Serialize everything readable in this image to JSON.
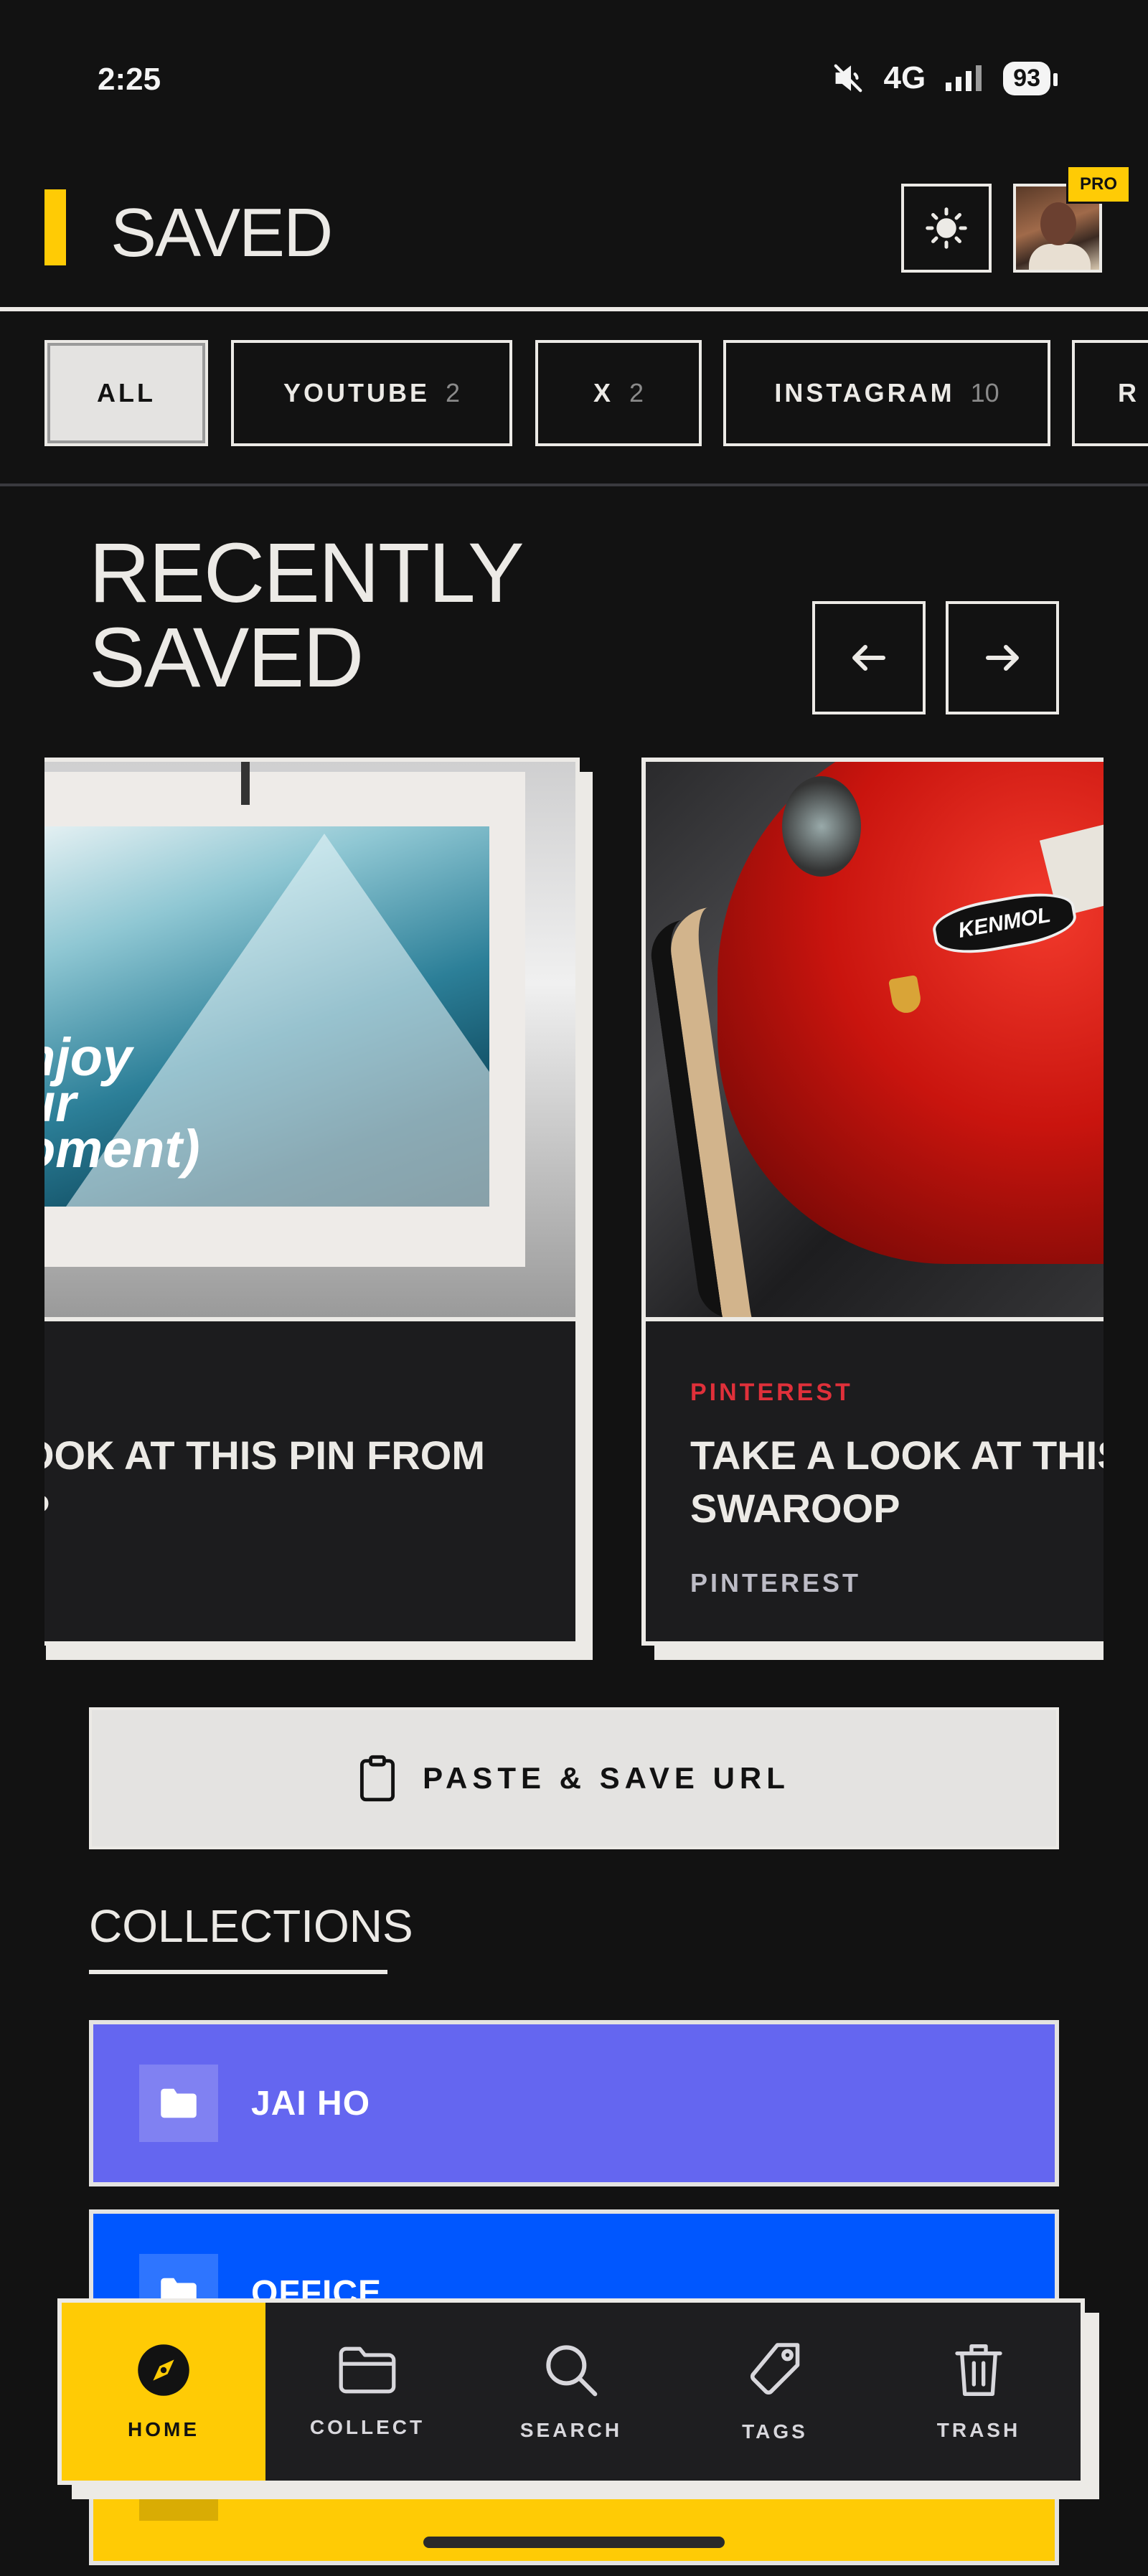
{
  "status_bar": {
    "time": "2:25",
    "network": "4G",
    "battery": "93"
  },
  "header": {
    "title": "SAVED",
    "pro_badge": "PRO"
  },
  "filters": [
    {
      "label": "ALL",
      "count": ""
    },
    {
      "label": "YOUTUBE",
      "count": "2"
    },
    {
      "label": "X",
      "count": "2"
    },
    {
      "label": "INSTAGRAM",
      "count": "10"
    },
    {
      "label": "R",
      "count": ""
    }
  ],
  "recently_saved": {
    "title_line1": "RECENTLY",
    "title_line2": "SAVED",
    "cards": [
      {
        "source": "",
        "title": "OOK AT THIS PIN FROM P",
        "title_line1": "OOK AT THIS PIN FROM",
        "title_line2": "P",
        "meta": "",
        "image_text_1": "njoy",
        "image_text_2": "ur",
        "image_text_3": "oment)"
      },
      {
        "source": "PINTEREST",
        "title_line1": "TAKE A LOOK AT THIS",
        "title_line2": "SWAROOP",
        "meta": "PINTEREST",
        "sticker": "KENMOL"
      }
    ]
  },
  "paste_button": {
    "label": "PASTE & SAVE URL"
  },
  "collections": {
    "title": "COLLECTIONS",
    "items": [
      {
        "name": "JAI HO",
        "color": "#6466F0"
      },
      {
        "name": "OFFICE",
        "color": "#0057FF"
      },
      {
        "name": "",
        "color": "#FFCB05"
      }
    ]
  },
  "bottom_nav": [
    {
      "label": "HOME",
      "icon": "compass-icon",
      "active": true
    },
    {
      "label": "COLLECT",
      "icon": "folder-icon",
      "active": false
    },
    {
      "label": "SEARCH",
      "icon": "search-icon",
      "active": false
    },
    {
      "label": "TAGS",
      "icon": "tag-icon",
      "active": false
    },
    {
      "label": "TRASH",
      "icon": "trash-icon",
      "active": false
    }
  ],
  "colors": {
    "accent": "#FFCB05",
    "background": "#121212",
    "source_red": "#E0303A"
  }
}
